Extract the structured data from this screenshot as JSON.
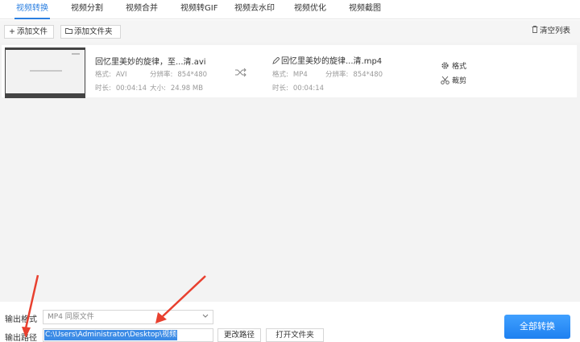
{
  "tabs": [
    {
      "label": "视频转换",
      "active": true
    },
    {
      "label": "视频分割"
    },
    {
      "label": "视频合并"
    },
    {
      "label": "视频转GIF"
    },
    {
      "label": "视频去水印"
    },
    {
      "label": "视频优化"
    },
    {
      "label": "视频截图"
    }
  ],
  "toolbar": {
    "add_file": "添加文件",
    "add_folder": "添加文件夹",
    "clear_list": "清空列表"
  },
  "file": {
    "source_name": "回忆里美妙的旋律，至...清.avi",
    "source_format_label": "格式:",
    "source_format": "AVI",
    "source_resolution_label": "分辨率:",
    "source_resolution": "854*480",
    "source_duration_label": "时长:",
    "source_duration": "00:04:14",
    "source_size_label": "大小:",
    "source_size": "24.98 MB",
    "output_name": "回忆里美妙的旋律...清.mp4",
    "output_format_label": "格式:",
    "output_format": "MP4",
    "output_resolution_label": "分辨率:",
    "output_resolution": "854*480",
    "output_duration_label": "时长:",
    "output_duration": "00:04:14",
    "action_format": "格式",
    "action_cut": "裁剪"
  },
  "bottom": {
    "output_format_label": "输出格式",
    "output_format_value": "MP4  同原文件",
    "output_path_label": "输出路径",
    "output_path_value": "C:\\Users\\Administrator\\Desktop\\视频",
    "change_path": "更改路径",
    "open_folder": "打开文件夹",
    "convert_all": "全部转换"
  },
  "colors": {
    "accent": "#2b7fe0",
    "convert_button": "#2b8cf5",
    "annotation_arrow": "#e8402f"
  }
}
